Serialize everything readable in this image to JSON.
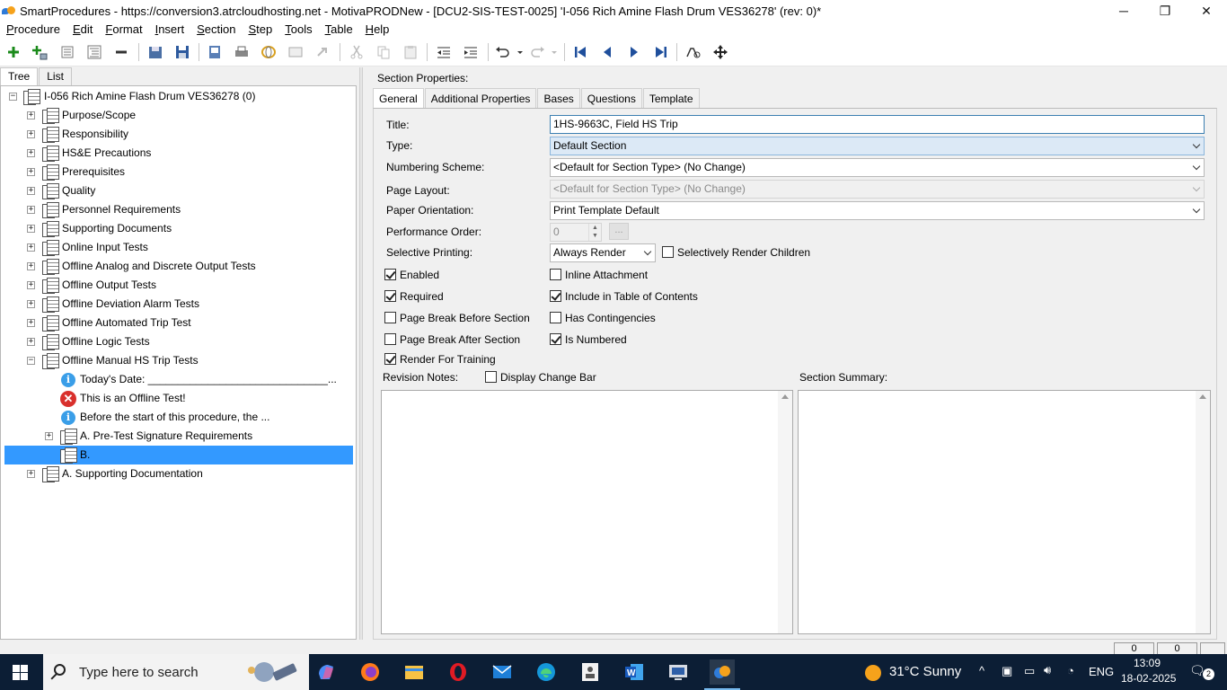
{
  "window": {
    "title": "SmartProcedures - https://conversion3.atrcloudhosting.net - MotivaPRODNew - [DCU2-SIS-TEST-0025] 'I-056 Rich Amine Flash Drum VES36278' (rev: 0)*",
    "min": "─",
    "max": "❐",
    "close": "✕"
  },
  "menu": [
    {
      "u": "P",
      "rest": "rocedure"
    },
    {
      "u": "E",
      "rest": "dit"
    },
    {
      "u": "F",
      "rest": "ormat"
    },
    {
      "u": "I",
      "rest": "nsert"
    },
    {
      "u": "S",
      "rest": "ection"
    },
    {
      "u": "S",
      "rest": "tep"
    },
    {
      "u": "T",
      "rest": "ools"
    },
    {
      "u": "T",
      "rest": "able"
    },
    {
      "u": "H",
      "rest": "elp"
    }
  ],
  "left_tabs": {
    "tree": "Tree",
    "list": "List"
  },
  "tree": {
    "root": "I-056 Rich Amine Flash Drum VES36278 (0)",
    "items": [
      "Purpose/Scope",
      "Responsibility",
      "HS&E Precautions",
      "Prerequisites",
      "Quality",
      "Personnel Requirements",
      "Supporting Documents",
      "Online Input Tests",
      "Offline Analog and Discrete Output Tests",
      "Offline Output Tests",
      "Offline Deviation Alarm Tests",
      "Offline Automated Trip Test",
      "Offline Logic Tests",
      "Offline Manual HS Trip Tests"
    ],
    "children": {
      "date": "Today's Date: ______________________________...",
      "offline": "This is an Offline Test!",
      "before": "Before the start of this procedure, the ...",
      "pretest": "A. Pre-Test Signature Requirements",
      "b": "B."
    },
    "last": "A. Supporting Documentation"
  },
  "right": {
    "section_props": "Section Properties:",
    "tabs": [
      "General",
      "Additional Properties",
      "Bases",
      "Questions",
      "Template"
    ],
    "labels": {
      "title": "Title:",
      "type": "Type:",
      "numbering": "Numbering Scheme:",
      "page_layout": "Page Layout:",
      "paper_orientation": "Paper Orientation:",
      "performance_order": "Performance Order:",
      "selective_printing": "Selective Printing:"
    },
    "values": {
      "title": "1HS-9663C, Field HS Trip",
      "type": "Default Section",
      "numbering": "<Default for Section Type> (No Change)",
      "page_layout": "<Default for Section Type> (No Change)",
      "paper_orientation": "Print Template Default",
      "performance_order": "0",
      "selective_printing": "Always Render",
      "dots": "..."
    },
    "checks": {
      "selectively_render_children": {
        "label": "Selectively Render Children",
        "checked": false
      },
      "enabled": {
        "label": "Enabled",
        "checked": true
      },
      "inline_attachment": {
        "label": "Inline Attachment",
        "checked": false
      },
      "required": {
        "label": "Required",
        "checked": true
      },
      "include_toc": {
        "label": "Include in Table of Contents",
        "checked": true
      },
      "page_break_before": {
        "label": "Page Break Before Section",
        "checked": false
      },
      "has_contingencies": {
        "label": "Has Contingencies",
        "checked": false
      },
      "page_break_after": {
        "label": "Page Break After Section",
        "checked": false
      },
      "is_numbered": {
        "label": "Is Numbered",
        "checked": true
      },
      "render_training": {
        "label": "Render For Training",
        "checked": true
      },
      "display_change_bar": {
        "label": "Display Change Bar",
        "checked": false
      }
    },
    "revision_notes": "Revision Notes:",
    "section_summary": "Section Summary:"
  },
  "status": {
    "cell1": "0",
    "cell2": "0"
  },
  "taskbar": {
    "search_placeholder": "Type here to search",
    "weather": "31°C  Sunny",
    "lang": "ENG",
    "time": "13:09",
    "date": "18-02-2025",
    "notif_count": "2"
  }
}
